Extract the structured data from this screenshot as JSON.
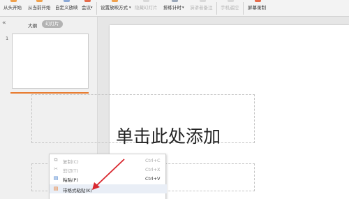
{
  "ribbon": {
    "play_from_start": "从头开始",
    "play_from_current": "从当前开始",
    "custom_show": "自定义放映",
    "meeting": "会议",
    "setup_show": "设置放映方式",
    "hide_slide": "隐藏幻灯片",
    "rehearse": "排练计时",
    "presenter_notes": "演讲者备注",
    "phone_remote": "手机遥控",
    "screen_record": "屏幕录制",
    "dropdown_caret": "▾"
  },
  "left_pane": {
    "collapse": "«",
    "tab_outline": "大纲",
    "tab_slides": "幻灯片",
    "slide_number": "1"
  },
  "slide": {
    "title_placeholder": "单击此处添加"
  },
  "context_menu": {
    "items": [
      {
        "label": "复制(C)",
        "shortcut": "Ctrl+C",
        "icon": "⧉"
      },
      {
        "label": "剪切(T)",
        "shortcut": "Ctrl+X",
        "icon": "✂"
      },
      {
        "label": "粘贴(P)",
        "shortcut": "Ctrl+V",
        "icon": "▤"
      },
      {
        "label": "带格式粘贴(K)",
        "shortcut": "",
        "icon": "▤"
      }
    ]
  },
  "colors": {
    "accent_orange": "#e87a2d",
    "annotation_red": "#d9282f",
    "icon_blue": "#3c78c8"
  }
}
